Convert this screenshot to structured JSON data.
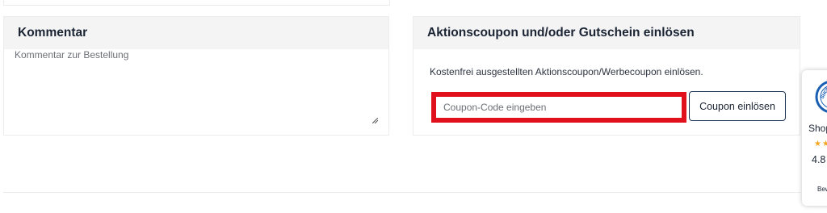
{
  "comment_section": {
    "title": "Kommentar",
    "placeholder": "Kommentar zur Bestellung"
  },
  "coupon_section": {
    "title": "Aktionscoupon und/oder Gutschein einlösen",
    "description": "Kostenfrei ausgestellten Aktionscoupon/Werbecoupon einlösen.",
    "input_placeholder": "Coupon-Code eingeben",
    "button_label": "Coupon einlösen"
  },
  "trust_badge": {
    "name": "Shop",
    "stars": "★★",
    "score": "4.8",
    "reviews_label": "Bew",
    "logo_text": "SHOP",
    "logo_icon": "shopvote-seal-icon",
    "star_color": "#f3a521",
    "logo_color": "#1a5fb4"
  },
  "colors": {
    "highlight": "#e0101c",
    "header_bg": "#f4f4f5",
    "button_border": "#1b3552"
  }
}
